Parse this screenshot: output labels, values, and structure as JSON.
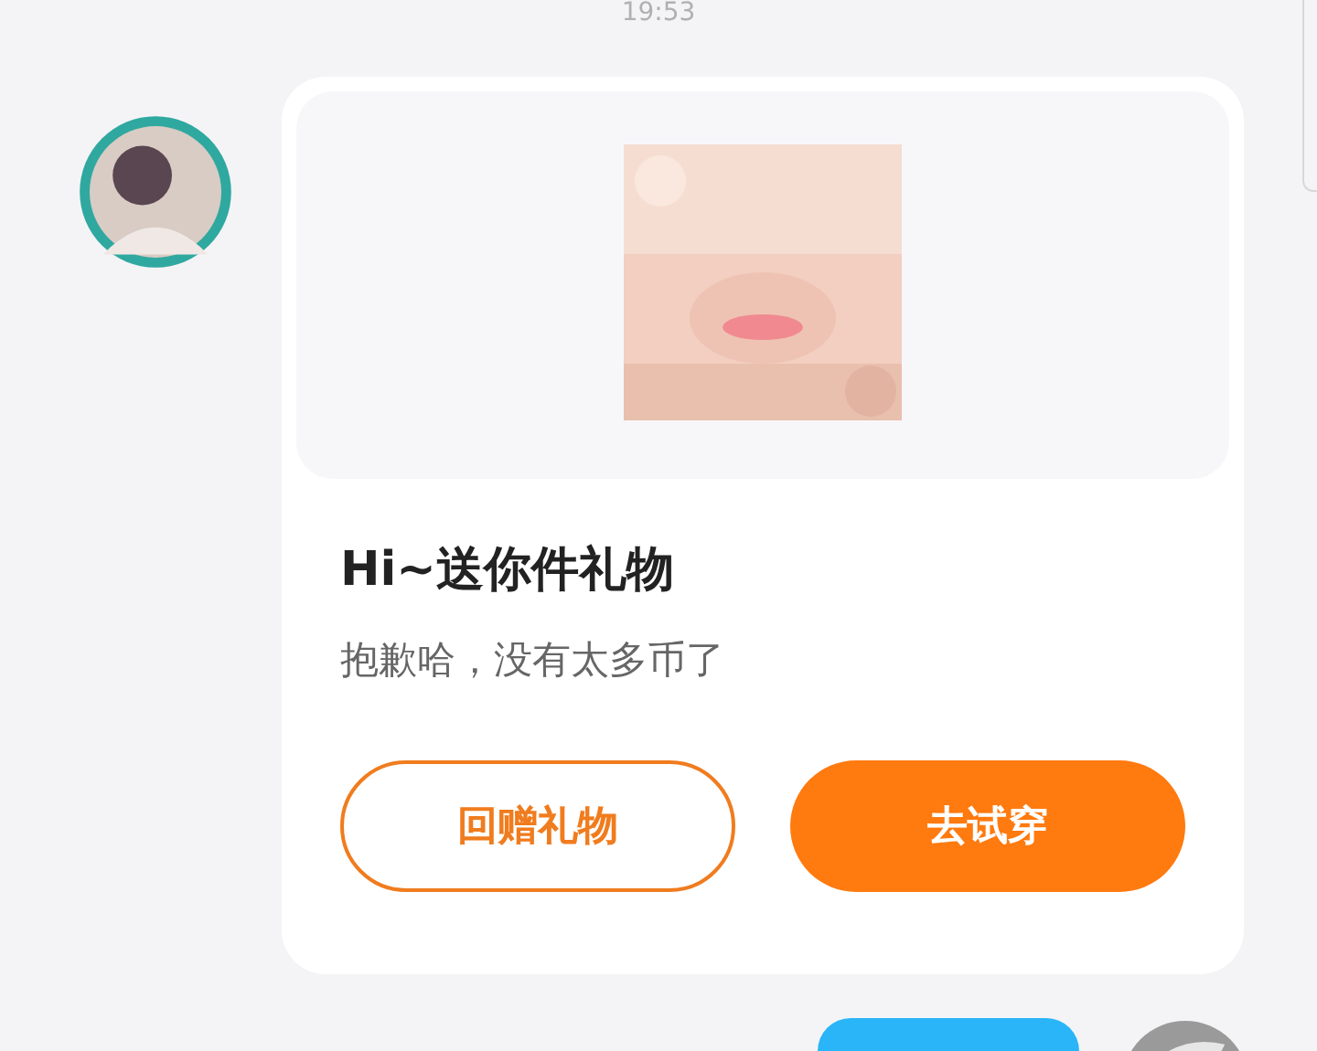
{
  "time": "19:53",
  "gift_card": {
    "title": "Hi~送你件礼物",
    "message": "抱歉哈，没有太多币了",
    "buttons": [
      {
        "label": "回赠礼物",
        "kind": "outline"
      },
      {
        "label": "去试穿",
        "kind": "filled"
      }
    ]
  }
}
